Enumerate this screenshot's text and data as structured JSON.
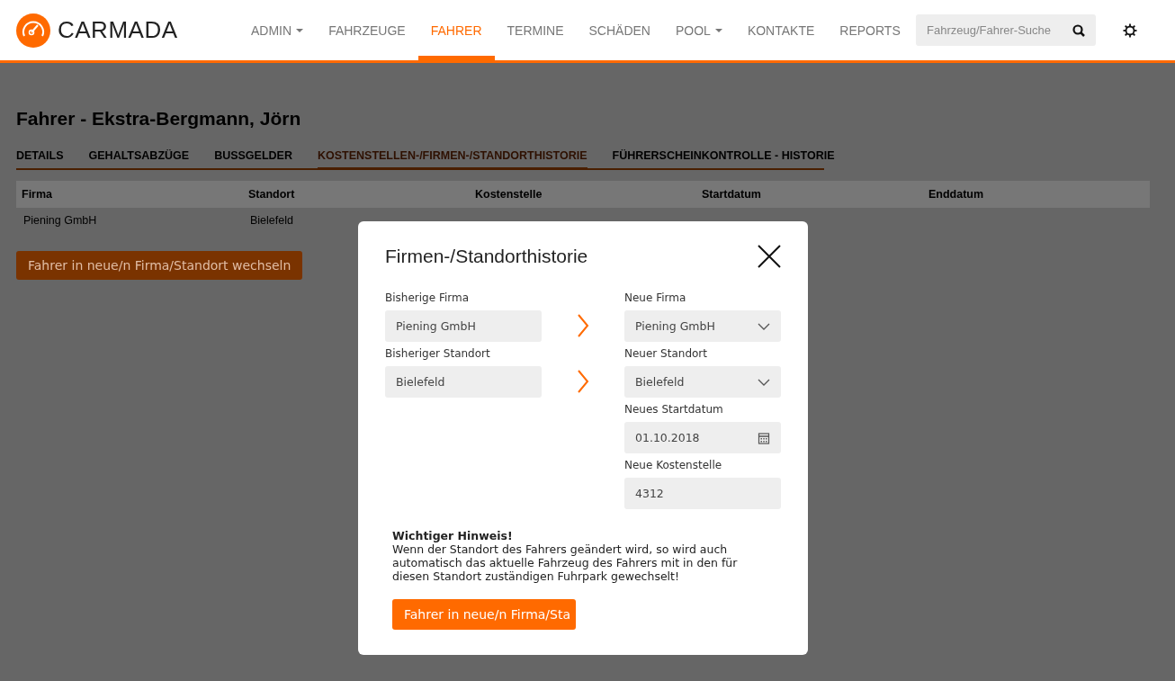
{
  "header": {
    "logo": "CARMADA",
    "nav": [
      {
        "label": "ADMIN",
        "selected": false,
        "dropdown": true
      },
      {
        "label": "FAHRZEUGE",
        "selected": false,
        "dropdown": false
      },
      {
        "label": "FAHRER",
        "selected": true,
        "dropdown": false
      },
      {
        "label": "TERMINE",
        "selected": false,
        "dropdown": false
      },
      {
        "label": "SCHÄDEN",
        "selected": false,
        "dropdown": false
      },
      {
        "label": "POOL",
        "selected": false,
        "dropdown": true
      },
      {
        "label": "KONTAKTE",
        "selected": false,
        "dropdown": false
      },
      {
        "label": "REPORTS",
        "selected": false,
        "dropdown": false
      }
    ],
    "search": {
      "placeholder": "Fahrzeug/Fahrer-Suche"
    }
  },
  "page": {
    "title": "Fahrer - Ekstra-Bergmann, Jörn",
    "tabs": [
      {
        "label": "DETAILS",
        "selected": false
      },
      {
        "label": "GEHALTSABZÜGE",
        "selected": false
      },
      {
        "label": "BUSSGELDER",
        "selected": false
      },
      {
        "label": "KOSTENSTELLEN-/FIRMEN-/STANDORTHISTORIE",
        "selected": true
      },
      {
        "label": "FÜHRERSCHEINKONTROLLE - HISTORIE",
        "selected": false
      }
    ],
    "table": {
      "columns": [
        "Firma",
        "Standort",
        "Kostenstelle",
        "Startdatum",
        "Enddatum"
      ],
      "rows": [
        [
          "Piening GmbH",
          "Bielefeld"
        ]
      ]
    },
    "action_button": "Fahrer in neue/n Firma/Standort wechseln"
  },
  "modal": {
    "title": "Firmen-/Standorthistorie",
    "rows": [
      {
        "left": {
          "label": "Bisherige Firma",
          "value": "Piening GmbH"
        },
        "right": {
          "kind": "select",
          "label": "Neue Firma",
          "value": "Piening GmbH"
        }
      },
      {
        "left": {
          "label": "Bisheriger Standort",
          "value": "Bielefeld"
        },
        "right": {
          "kind": "select",
          "label": "Neuer Standort",
          "value": "Bielefeld"
        }
      },
      {
        "right": {
          "kind": "date",
          "label": "Neues Startdatum",
          "value": "01.10.2018"
        }
      },
      {
        "right": {
          "kind": "text",
          "label": "Neue Kostenstelle",
          "value": "4312"
        }
      }
    ],
    "notice": {
      "heading": "Wichtiger Hinweis!",
      "text": "Wenn der Standort des Fahrers geändert wird, so wird auch automatisch das aktuelle Fahrzeug des Fahrers mit in den für diesen Standort zuständigen Fuhrpark gewechselt!"
    },
    "submit_button": "Fahrer in neue/n Firma/Sta"
  }
}
